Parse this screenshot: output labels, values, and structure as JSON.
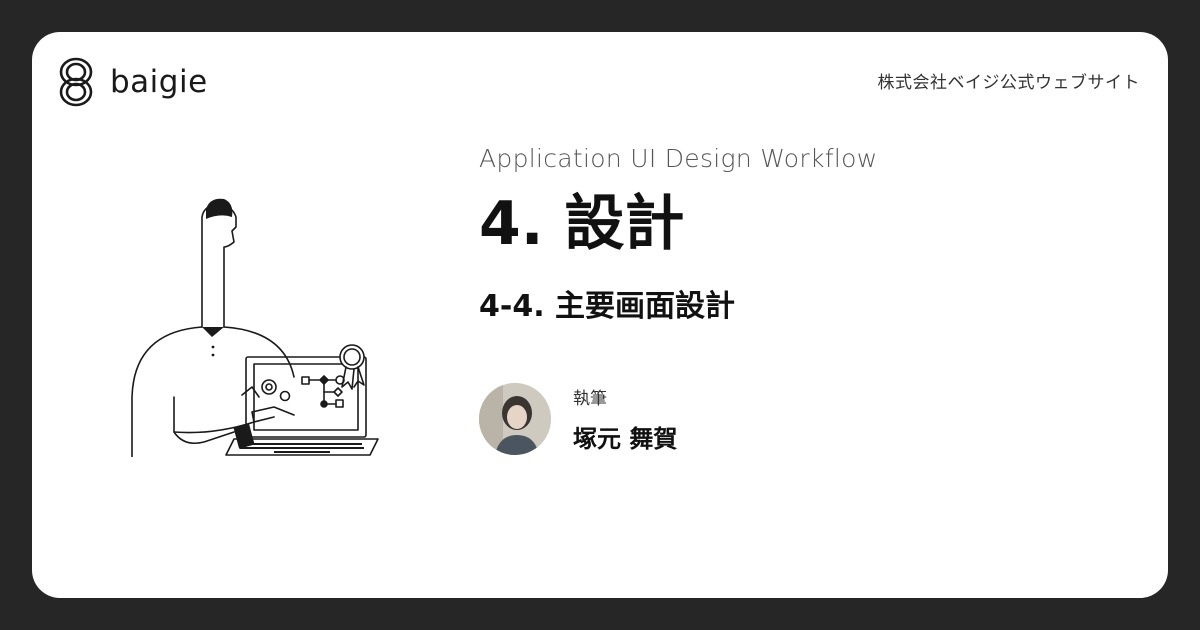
{
  "brand": {
    "name": "baigie",
    "logo_icon": "baigie-logo-icon"
  },
  "header": {
    "site_link": "株式会社ベイジ公式ウェブサイト"
  },
  "article": {
    "series": "Application UI Design Workflow",
    "chapter": "4. 設計",
    "section": "4-4. 主要画面設計"
  },
  "author": {
    "role": "執筆",
    "name": "塚元 舞賀"
  },
  "colors": {
    "background": "#262626",
    "card": "#ffffff",
    "text": "#111111"
  }
}
